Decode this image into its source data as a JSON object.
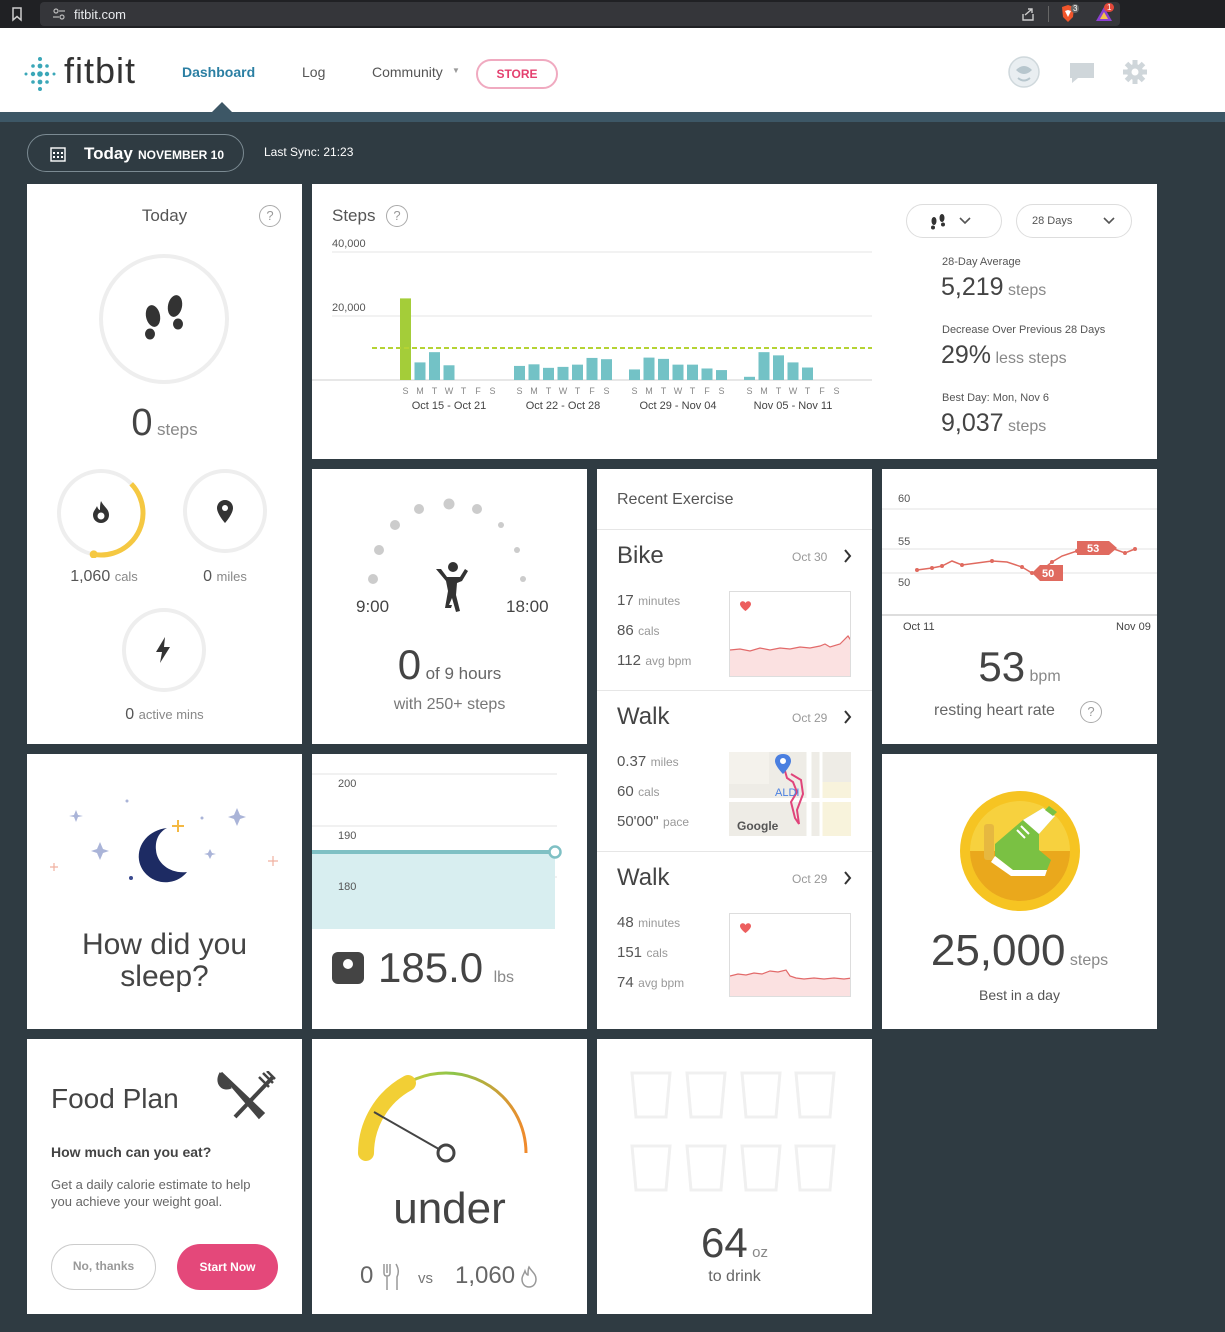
{
  "browser": {
    "url": "fitbit.com",
    "brave_badge": "3",
    "alert_badge": "1"
  },
  "header": {
    "logo": "fitbit",
    "nav": {
      "dashboard": "Dashboard",
      "log": "Log",
      "community": "Community",
      "store": "STORE"
    }
  },
  "date_bar": {
    "today": "Today",
    "date": "NOVEMBER 10",
    "sync": "Last Sync: 21:23"
  },
  "today_tile": {
    "title": "Today",
    "help": "?",
    "steps_value": "0",
    "steps_unit": "steps",
    "cals_value": "1,060",
    "cals_unit": "cals",
    "cals_progress": 0.4,
    "miles_value": "0",
    "miles_unit": "miles",
    "active_value": "0",
    "active_unit": "active mins"
  },
  "steps_tile": {
    "title": "Steps",
    "help": "?",
    "range_select": "28 Days",
    "avg_label": "28-Day Average",
    "avg_value": "5,219",
    "avg_unit": "steps",
    "dec_label": "Decrease Over Previous 28 Days",
    "dec_value": "29%",
    "dec_unit": "less steps",
    "best_label": "Best Day: Mon, Nov 6",
    "best_value": "9,037",
    "best_unit": "steps"
  },
  "chart_data": {
    "type": "bar",
    "title": "Steps",
    "ylim": [
      0,
      40000
    ],
    "y_ticks": [
      "40,000",
      "20,000"
    ],
    "average_line": 10000,
    "day_letters": [
      "S",
      "M",
      "T",
      "W",
      "T",
      "F",
      "S"
    ],
    "week_labels": [
      "Oct 15 - Oct 21",
      "Oct 22 - Oct 28",
      "Oct 29 - Nov 04",
      "Nov 05 - Nov 11"
    ],
    "series": [
      {
        "values": [
          25500,
          5500,
          8700,
          4600,
          0,
          0,
          0
        ]
      },
      {
        "values": [
          4400,
          4900,
          3800,
          4100,
          4800,
          6900,
          6500
        ]
      },
      {
        "values": [
          3300,
          7000,
          6600,
          4800,
          4800,
          3600,
          3100
        ]
      },
      {
        "values": [
          1000,
          8700,
          7700,
          5500,
          3900,
          0,
          0
        ]
      }
    ],
    "colors": {
      "bar": "#73c2c6",
      "best": "#a4cd39",
      "average": "#b5d334"
    }
  },
  "hourly_tile": {
    "start": "9:00",
    "end": "18:00",
    "value": "0",
    "of": "of 9 hours",
    "sub": "with 250+ steps"
  },
  "exercise_tile": {
    "title": "Recent Exercise",
    "items": [
      {
        "name": "Bike",
        "date": "Oct 30",
        "l1v": "17",
        "l1u": "minutes",
        "l2v": "86",
        "l2u": "cals",
        "l3v": "112",
        "l3u": "avg bpm"
      },
      {
        "name": "Walk",
        "date": "Oct 29",
        "l1v": "0.37",
        "l1u": "miles",
        "l2v": "60",
        "l2u": "cals",
        "l3v": "50'00\"",
        "l3u": "pace",
        "map_store": "ALDI",
        "map_brand": "Google"
      },
      {
        "name": "Walk",
        "date": "Oct 29",
        "l1v": "48",
        "l1u": "minutes",
        "l2v": "151",
        "l2u": "cals",
        "l3v": "74",
        "l3u": "avg bpm"
      }
    ]
  },
  "heart_tile": {
    "y_ticks": [
      "60",
      "55",
      "50"
    ],
    "x_start": "Oct 11",
    "x_end": "Nov 09",
    "tag_high": "53",
    "tag_low": "50",
    "value": "53",
    "unit": "bpm",
    "label": "resting heart rate",
    "help": "?"
  },
  "sleep_tile": {
    "line1": "How did you",
    "line2": "sleep?"
  },
  "weight_tile": {
    "y_ticks": [
      "200",
      "190",
      "180"
    ],
    "value": "185.0",
    "unit": "lbs"
  },
  "badge_tile": {
    "value": "25,000",
    "unit": "steps",
    "label": "Best in a day"
  },
  "food_tile": {
    "title": "Food Plan",
    "question": "How much can you eat?",
    "desc1": "Get a daily calorie estimate to help",
    "desc2": "you achieve your weight goal.",
    "no_btn": "No, thanks",
    "start_btn": "Start Now"
  },
  "calorie_tile": {
    "status": "under",
    "eaten": "0",
    "vs": "vs",
    "burned": "1,060"
  },
  "water_tile": {
    "value": "64",
    "unit": "oz",
    "label": "to drink"
  }
}
